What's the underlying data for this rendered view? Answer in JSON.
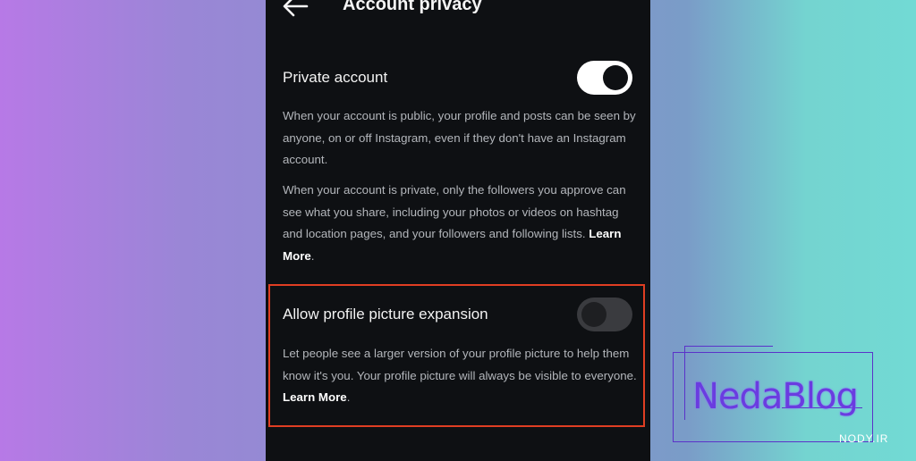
{
  "header": {
    "title": "Account privacy"
  },
  "private_account": {
    "title": "Private account",
    "toggle_state": "on",
    "desc_public": "When your account is public, your profile and posts can be seen by anyone, on or off Instagram, even if they don't have an Instagram account.",
    "desc_private": "When your account is private, only the followers you approve can see what you share, including your photos or videos on hashtag and location pages, and your followers and following lists.",
    "learn_more": "Learn More",
    "trailing": "."
  },
  "profile_picture_expansion": {
    "title": "Allow profile picture expansion",
    "toggle_state": "off",
    "desc": "Let people see a larger version of your profile picture to help them know it's you. Your profile picture will always be visible to everyone.",
    "learn_more": "Learn More",
    "trailing": "."
  },
  "watermark": {
    "brand": "NedaBlog",
    "site": "NODY.IR"
  },
  "colors": {
    "screen_bg": "#0e1013",
    "highlight_border": "#e03e22",
    "watermark": "#6a3ce0"
  },
  "icons": {
    "back": "arrow-left"
  }
}
